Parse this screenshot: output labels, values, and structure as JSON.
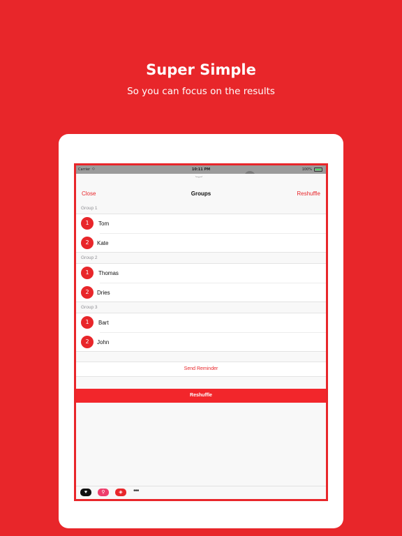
{
  "promo": {
    "headline": "Super Simple",
    "subline": "So you can focus on the results"
  },
  "status_bar": {
    "carrier": "Carrier",
    "wifi_icon": "wifi-icon",
    "time": "10:11 PM",
    "battery": "100%"
  },
  "nav": {
    "close_label": "Close",
    "title": "Groups",
    "reshuffle_label": "Reshuffle"
  },
  "groups": [
    {
      "header": "Group 1",
      "members": [
        {
          "rank": "1",
          "name": "Tom"
        },
        {
          "rank": "2",
          "name": "Kate"
        }
      ]
    },
    {
      "header": "Group 2",
      "members": [
        {
          "rank": "1",
          "name": "Thomas"
        },
        {
          "rank": "2",
          "name": "Dries"
        }
      ]
    },
    {
      "header": "Group 3",
      "members": [
        {
          "rank": "1",
          "name": "Bart"
        },
        {
          "rank": "2",
          "name": "John"
        }
      ]
    }
  ],
  "actions": {
    "send_reminder": "Send Reminder",
    "reshuffle": "Reshuffle"
  },
  "dock": {
    "icons": [
      "heart-app-icon",
      "search-app-icon",
      "cube-app-icon"
    ],
    "more": "•••"
  },
  "colors": {
    "brand_red": "#e8262a",
    "background": "#f8f8f8"
  }
}
